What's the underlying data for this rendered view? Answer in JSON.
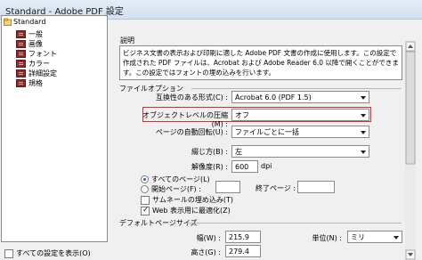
{
  "window": {
    "title": "Standard - Adobe PDF 設定"
  },
  "tree": {
    "root": "Standard",
    "items": [
      "一般",
      "画像",
      "フォント",
      "カラー",
      "詳細設定",
      "規格"
    ]
  },
  "show_all_label": "すべての設定を表示(O)",
  "description": {
    "title": "説明",
    "text": "ビジネス文書の表示および印刷に適した Adobe PDF 文書の作成に使用します。この設定で作成された PDF ファイルは、Acrobat および Adobe Reader 6.0 以降で開くことができます。この設定ではフォントの埋め込みを行います。"
  },
  "file_options": {
    "title": "ファイルオプション",
    "compat_label": "互換性のある形式(C) :",
    "compat_value": "Acrobat 6.0 (PDF 1.5)",
    "obj_level_label": "オブジェクトレベルの圧縮(M) :",
    "obj_level_value": "オフ",
    "rotate_label": "ページの自動回転(U) :",
    "rotate_value": "ファイルごとに一括",
    "binding_label": "綴じ方(B) :",
    "binding_value": "左",
    "resolution_label": "解像度(R) :",
    "resolution_value": "600",
    "resolution_unit": "dpi",
    "all_pages_label": "すべてのページ(L)",
    "page_range_label": "開始ページ(F) :",
    "end_page_label": "終了ページ :",
    "thumbnails_label": "サムネールの埋め込み(T)",
    "web_optimize_label": "Web 表示用に最適化(Z)"
  },
  "default_page_size": {
    "title": "デフォルトページサイズ",
    "width_label": "幅(W) :",
    "width_value": "215.9",
    "height_label": "高さ(G) :",
    "height_value": "279.4",
    "unit_label": "単位(N) :",
    "unit_value": "ミリ"
  }
}
